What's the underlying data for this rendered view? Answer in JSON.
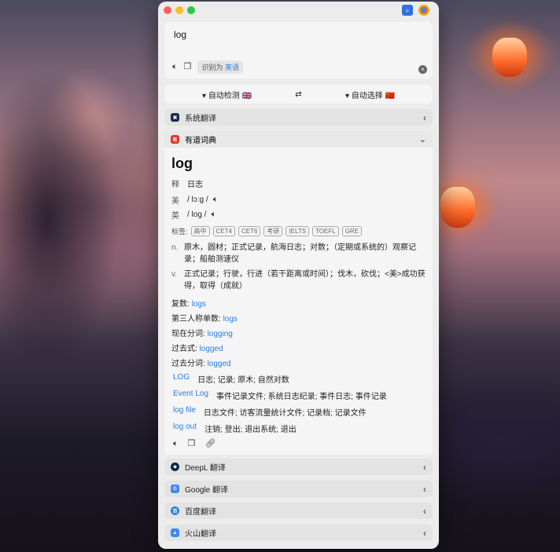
{
  "input": {
    "text": "log",
    "detected_label": "识别为",
    "detected_lang": "英语"
  },
  "lang_bar": {
    "source": "自动检测",
    "swap": "⇄",
    "target": "自动选择"
  },
  "services": {
    "system": "系统翻译",
    "youdao": "有道词典",
    "deepl": "DeepL 翻译",
    "google": "Google 翻译",
    "baidu": "百度翻译",
    "volc": "火山翻译"
  },
  "dict": {
    "word": "log",
    "shi_label": "释",
    "shi_value": "日志",
    "us_label": "美",
    "us_phonetic": "/ lɔːg /",
    "uk_label": "英",
    "uk_phonetic": "/ log /",
    "tags_label": "标签:",
    "tags": [
      "高中",
      "CET4",
      "CET6",
      "考研",
      "IELTS",
      "TOEFL",
      "GRE"
    ],
    "definitions": [
      {
        "pos": "n.",
        "text": "原木，圆材；正式记录，航海日志；对数；（定期或系统的）观察记录；船舶测速仪"
      },
      {
        "pos": "v.",
        "text": "正式记录；行驶，行进（若干距离或时间）；伐木，砍伐；<美>成功获得，取得（成就）"
      }
    ],
    "forms": [
      {
        "label": "复数:",
        "value": "logs"
      },
      {
        "label": "第三人称单数:",
        "value": "logs"
      },
      {
        "label": "现在分词:",
        "value": "logging"
      },
      {
        "label": "过去式:",
        "value": "logged"
      },
      {
        "label": "过去分词:",
        "value": "logged"
      }
    ],
    "phrases": [
      {
        "term": "LOG",
        "meaning": "日志; 记录; 原木; 自然对数"
      },
      {
        "term": "Event Log",
        "meaning": "事件记录文件; 系统日志纪录; 事件日志; 事件记录"
      },
      {
        "term": "log file",
        "meaning": "日志文件; 访客流量统计文件; 记录档; 记录文件"
      },
      {
        "term": "log out",
        "meaning": "注销; 登出; 退出系统; 退出"
      }
    ]
  }
}
